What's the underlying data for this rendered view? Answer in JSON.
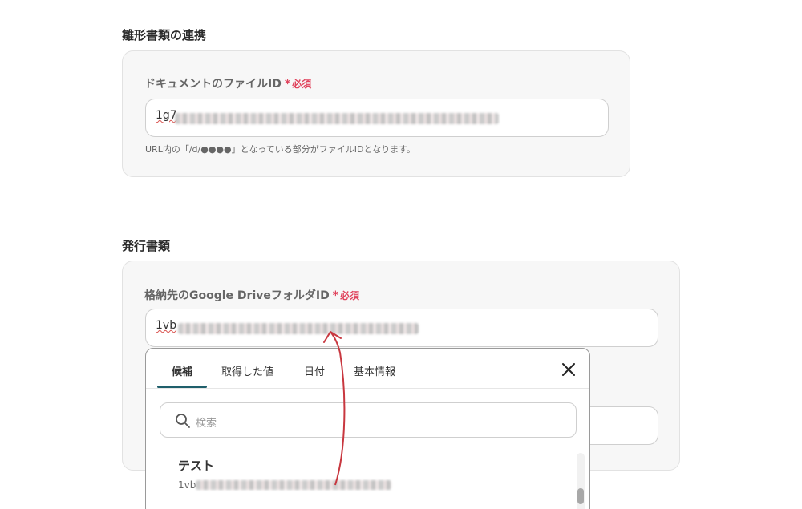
{
  "template_section": {
    "title": "雛形書類の連携",
    "doc_id_field": {
      "label": "ドキュメントのファイルID",
      "required_mark": "*",
      "required_text": "必須",
      "value_visible": "1g7",
      "help": "URL内の「/d/●●●●」となっている部分がファイルIDとなります。"
    }
  },
  "issue_section": {
    "title": "発行書類",
    "folder_field": {
      "label": "格納先のGoogle DriveフォルダID",
      "required_mark": "*",
      "required_text": "必須",
      "value_visible": "1vb"
    }
  },
  "dropdown": {
    "tabs": [
      "候補",
      "取得した値",
      "日付",
      "基本情報"
    ],
    "active_tab": "候補",
    "search_placeholder": "検索",
    "items": [
      {
        "title": "テスト",
        "sub_visible": "1vb"
      }
    ]
  },
  "colors": {
    "required": "#e0445d",
    "tab_accent": "#1f5f6b",
    "arrow": "#c8373f"
  },
  "icons": [
    "search-icon",
    "close-icon"
  ]
}
